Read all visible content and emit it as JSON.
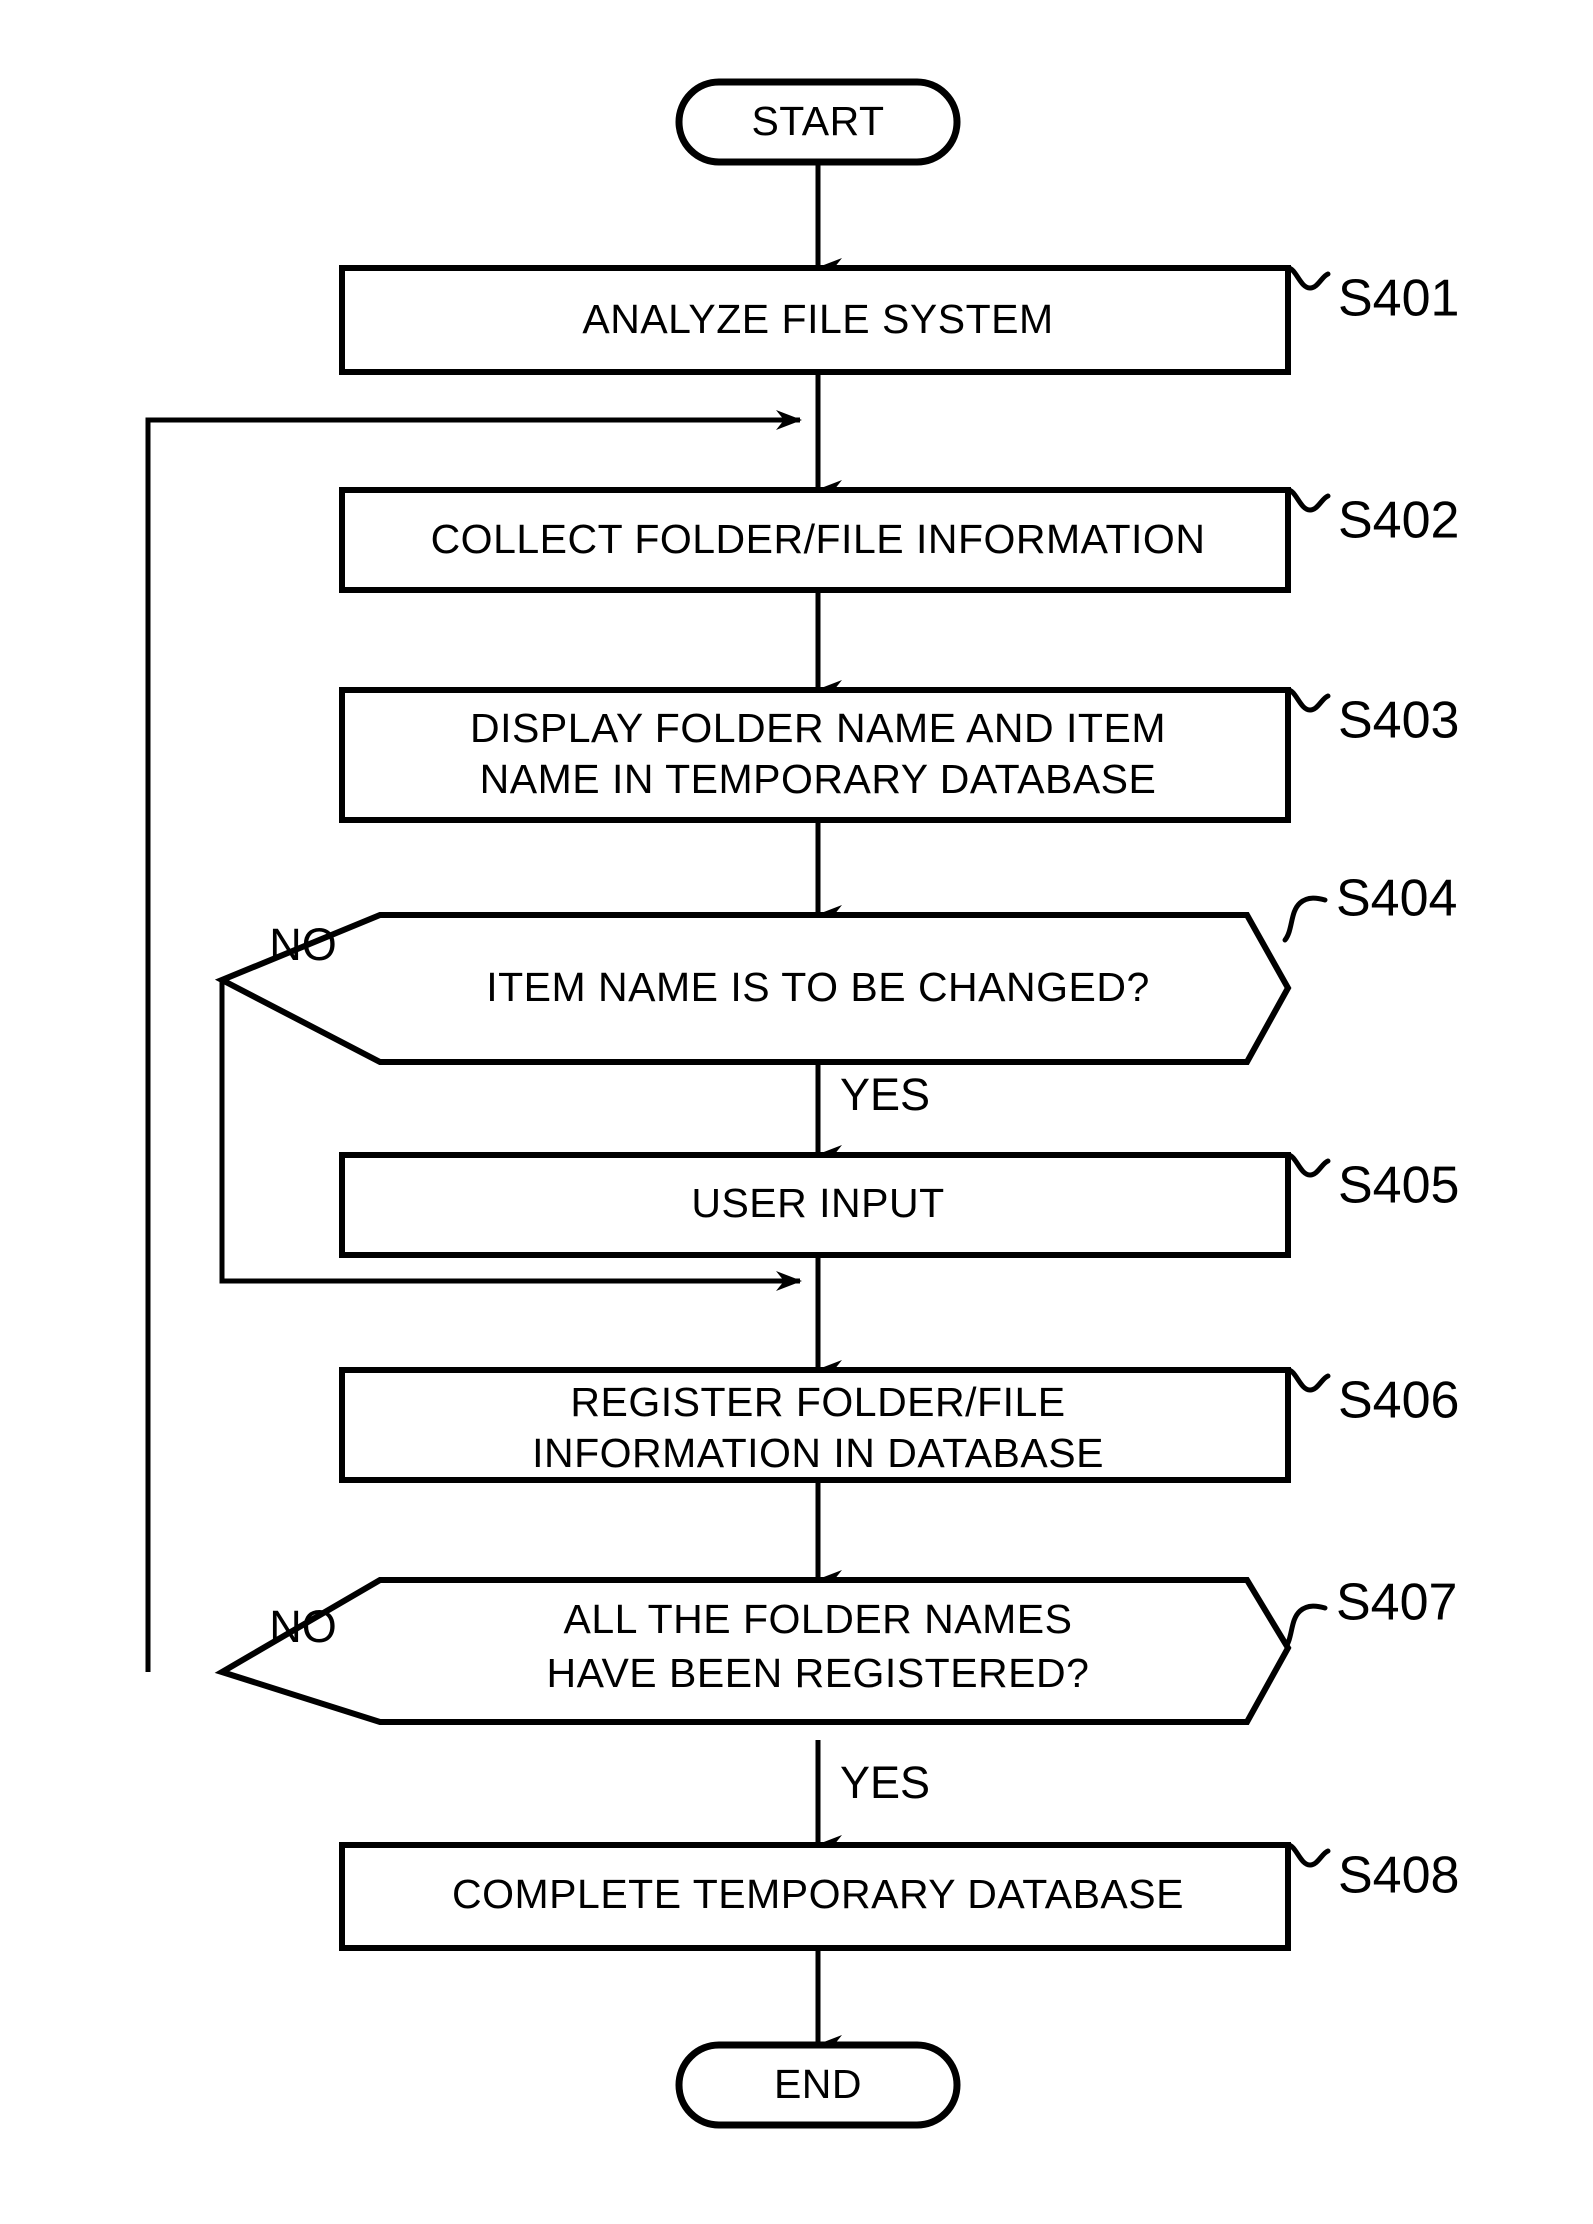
{
  "diagram": {
    "type": "flowchart",
    "orientation": "vertical",
    "nodes": {
      "start": {
        "kind": "terminal",
        "label": "START"
      },
      "s401": {
        "kind": "process",
        "step": "S401",
        "label": "ANALYZE FILE SYSTEM"
      },
      "s402": {
        "kind": "process",
        "step": "S402",
        "label": "COLLECT FOLDER/FILE INFORMATION"
      },
      "s403": {
        "kind": "process",
        "step": "S403",
        "line1": "DISPLAY FOLDER NAME AND ITEM",
        "line2": "NAME IN TEMPORARY DATABASE"
      },
      "s404": {
        "kind": "decision",
        "step": "S404",
        "label": "ITEM NAME IS TO BE CHANGED?",
        "yes": "YES",
        "no": "NO"
      },
      "s405": {
        "kind": "process",
        "step": "S405",
        "label": "USER INPUT"
      },
      "s406": {
        "kind": "process",
        "step": "S406",
        "line1": "REGISTER FOLDER/FILE",
        "line2": "INFORMATION IN DATABASE"
      },
      "s407": {
        "kind": "decision",
        "step": "S407",
        "line1": "ALL THE FOLDER NAMES",
        "line2": "HAVE BEEN REGISTERED?",
        "yes": "YES",
        "no": "NO"
      },
      "s408": {
        "kind": "process",
        "step": "S408",
        "label": "COMPLETE TEMPORARY DATABASE"
      },
      "end": {
        "kind": "terminal",
        "label": "END"
      }
    },
    "colors": {
      "stroke": "#000000",
      "fill": "#ffffff",
      "text": "#000000"
    }
  }
}
